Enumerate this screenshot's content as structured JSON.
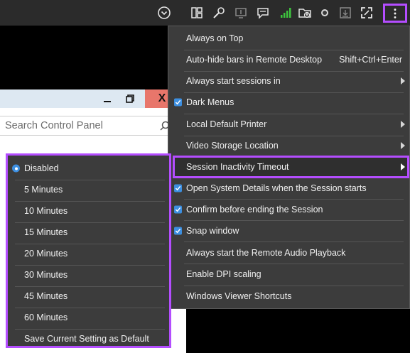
{
  "toolbar": {
    "icons": [
      "chevron-down-circle-icon",
      "layout-icon",
      "wrench-icon",
      "monitor-icon",
      "chat-icon",
      "signal-bars-icon",
      "folder-upload-icon",
      "record-dot-icon",
      "download-icon",
      "fullscreen-icon",
      "more-vertical-icon"
    ],
    "signal_color": "#3ec43e",
    "highlight_color": "#b44dff"
  },
  "remote": {
    "control_panel": {
      "search_placeholder": "Search Control Panel",
      "close_label": "X"
    }
  },
  "menu": {
    "items": [
      {
        "label": "Always on Top",
        "checked": false
      },
      {
        "label": "Auto-hide bars in Remote Desktop",
        "shortcut": "Shift+Ctrl+Enter"
      },
      {
        "label": "Always start sessions in",
        "submenu": true
      },
      {
        "label": "Dark Menus",
        "checked": true
      },
      {
        "label": "Local Default Printer",
        "submenu": true
      },
      {
        "label": "Video Storage Location",
        "submenu": true
      },
      {
        "label": "Session Inactivity Timeout",
        "submenu": true,
        "highlighted": true
      },
      {
        "label": "Open System Details when the Session starts",
        "checked": true
      },
      {
        "label": "Confirm before ending the Session",
        "checked": true
      },
      {
        "label": "Snap window",
        "checked": true
      },
      {
        "label": "Always start the Remote Audio Playback",
        "checked": false
      },
      {
        "label": "Enable DPI scaling",
        "checked": false
      },
      {
        "label": "Windows Viewer Shortcuts",
        "checked": false
      }
    ]
  },
  "submenu": {
    "selected": "Disabled",
    "items": [
      "Disabled",
      "5 Minutes",
      "10 Minutes",
      "15 Minutes",
      "20 Minutes",
      "30 Minutes",
      "45 Minutes",
      "60 Minutes"
    ],
    "footer": "Save Current Setting as Default"
  },
  "colors": {
    "menu_bg": "#3c3c3c",
    "check_blue": "#3d8fe0",
    "toolbar_bg": "#2b2b2b"
  }
}
